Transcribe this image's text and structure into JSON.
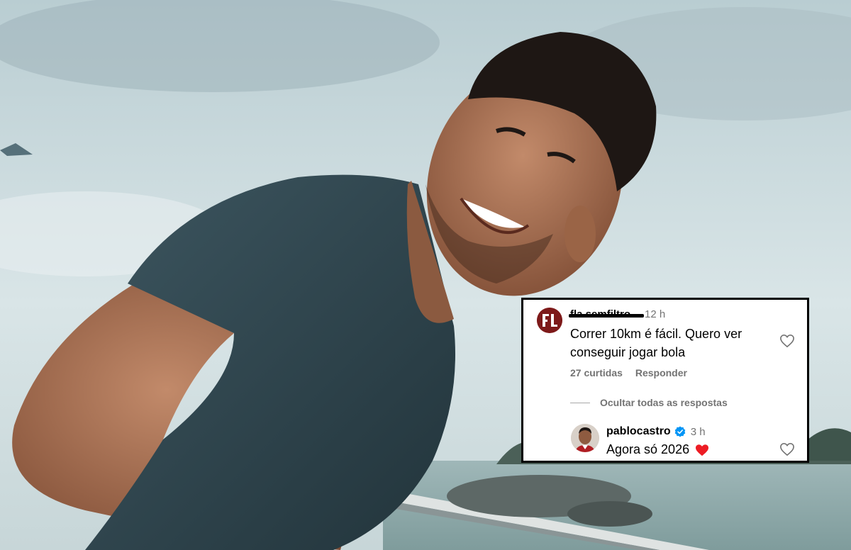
{
  "comment": {
    "username": "fla.semfiltro",
    "time": "12 h",
    "text": "Correr 10km é fácil. Quero ver conseguir jogar bola",
    "likes": "27 curtidas",
    "reply_label": "Responder",
    "hide_replies_label": "Ocultar todas as respostas"
  },
  "reply": {
    "username": "pablocastro",
    "time": "3 h",
    "text": "Agora só 2026",
    "emoji": "red-heart"
  },
  "icons": {
    "like": "heart-outline-icon",
    "verified": "verified-badge-icon"
  },
  "colors": {
    "verified_blue": "#0095f6",
    "heart_red": "#ed1c24",
    "muted_text": "#737373"
  }
}
